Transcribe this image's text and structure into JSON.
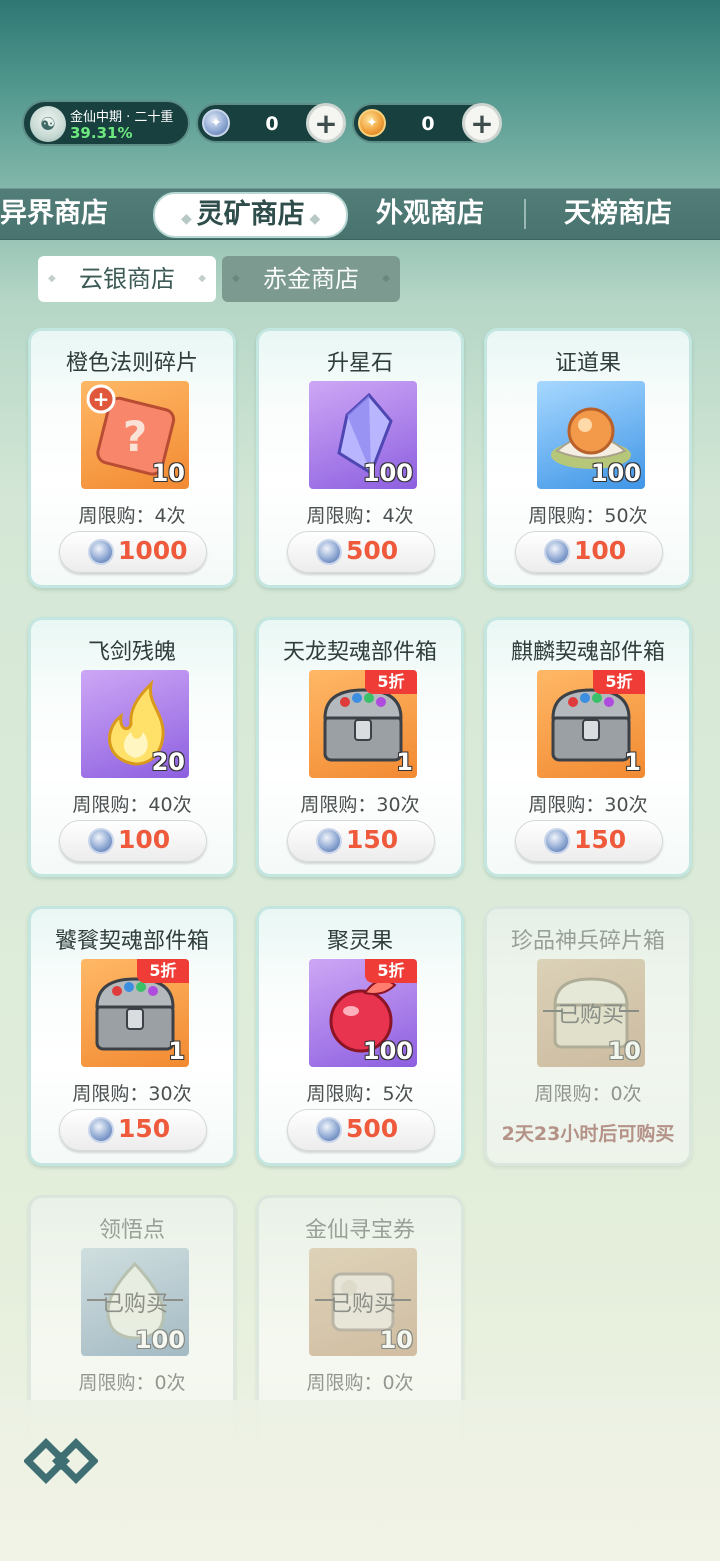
{
  "header": {
    "realm_label": "金仙中期 · 二十重",
    "realm_progress": "39.31%",
    "currency_silver": "0",
    "currency_gold": "0"
  },
  "main_tabs": [
    "异界商店",
    "灵矿商店",
    "外观商店",
    "天榜商店"
  ],
  "main_tab_active": "灵矿商店",
  "sub_tabs": [
    "云银商店",
    "赤金商店"
  ],
  "sub_tab_active": "云银商店",
  "items": [
    {
      "name": "橙色法则碎片",
      "qty": "10",
      "limit": "周限购：4次",
      "price": "1000"
    },
    {
      "name": "升星石",
      "qty": "100",
      "limit": "周限购：4次",
      "price": "500"
    },
    {
      "name": "证道果",
      "qty": "100",
      "limit": "周限购：50次",
      "price": "100"
    },
    {
      "name": "飞剑残魄",
      "qty": "20",
      "limit": "周限购：40次",
      "price": "100"
    },
    {
      "name": "天龙契魂部件箱",
      "qty": "1",
      "badge": "5折",
      "limit": "周限购：30次",
      "price": "150"
    },
    {
      "name": "麒麟契魂部件箱",
      "qty": "1",
      "badge": "5折",
      "limit": "周限购：30次",
      "price": "150"
    },
    {
      "name": "饕餮契魂部件箱",
      "qty": "1",
      "badge": "5折",
      "limit": "周限购：30次",
      "price": "150"
    },
    {
      "name": "聚灵果",
      "qty": "100",
      "badge": "5折",
      "limit": "周限购：5次",
      "price": "500"
    },
    {
      "name": "珍品神兵碎片箱",
      "qty": "10",
      "limit": "周限购：0次",
      "sold": "已购买",
      "restock": "2天23小时后可购买"
    },
    {
      "name": "领悟点",
      "qty": "100",
      "limit": "周限购：0次",
      "sold": "已购买"
    },
    {
      "name": "金仙寻宝券",
      "qty": "10",
      "limit": "周限购：0次",
      "sold": "已购买"
    }
  ],
  "colors": {
    "accent_price": "#ef5a3c",
    "badge": "#ef3c36",
    "progress_text": "#6ee87e",
    "restock_text": "#e63328"
  },
  "icons": {
    "silver_currency": "silver-coin-icon",
    "gold_currency": "gold-coin-icon",
    "add": "plus-icon",
    "home": "logo-icon"
  }
}
